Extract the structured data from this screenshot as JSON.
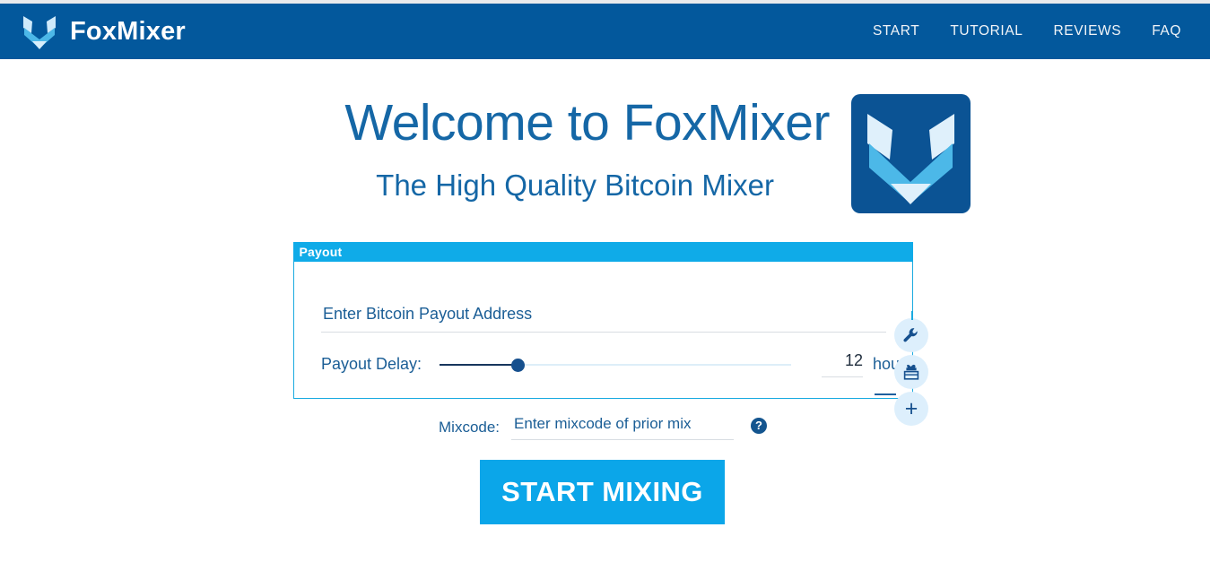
{
  "header": {
    "brand_name": "FoxMixer",
    "logo_icon": "fox-logo-icon",
    "nav": [
      {
        "label": "START",
        "name": "nav-link-start"
      },
      {
        "label": "TUTORIAL",
        "name": "nav-link-tutorial"
      },
      {
        "label": "REVIEWS",
        "name": "nav-link-reviews"
      },
      {
        "label": "FAQ",
        "name": "nav-link-faq"
      }
    ]
  },
  "hero": {
    "title": "Welcome to FoxMixer",
    "subtitle": "The High Quality Bitcoin Mixer",
    "logo_icon": "fox-head-logo-icon"
  },
  "payout": {
    "panel_title": "Payout",
    "address_value": "",
    "address_placeholder": "Enter Bitcoin Payout Address",
    "delay_label": "Payout Delay:",
    "delay_value": "12",
    "delay_unit": "hours",
    "delay_percent": 20
  },
  "tools": [
    {
      "name": "settings-wrench-button",
      "icon": "wrench-icon"
    },
    {
      "name": "gift-box-button",
      "icon": "gift-box-icon"
    },
    {
      "name": "add-payout-address-button",
      "icon": "plus-icon",
      "label": "+"
    }
  ],
  "mixcode": {
    "label": "Mixcode:",
    "value": "",
    "placeholder": "Enter mixcode of prior mix",
    "help_icon": "help-question-icon",
    "help_label": "?"
  },
  "actions": {
    "start_mixing_label": "START MIXING"
  },
  "colors": {
    "header_blue": "#03589c",
    "accent_cyan": "#0ba6e9",
    "panel_border": "#1aaae0",
    "text_blue": "#1b5e96",
    "title_blue": "#1567a6",
    "logo_dark_blue": "#0b5394",
    "logo_light_blue": "#4cb8e8"
  }
}
